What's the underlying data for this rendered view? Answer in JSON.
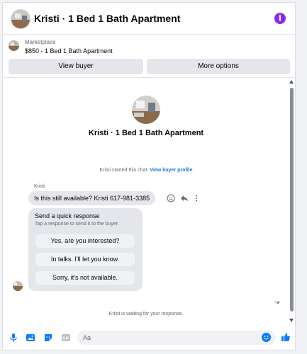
{
  "header": {
    "title": "Kristi · 1 Bed 1 Bath Apartment",
    "info_glyph": "i",
    "info_color": "#8a2be2"
  },
  "marketplace": {
    "label": "Marketplace",
    "price_title": "$850 - 1 Bed 1 Bath Apartment",
    "view_buyer": "View buyer",
    "more_options": "More options"
  },
  "thread": {
    "title": "Kristi · 1 Bed 1 Bath Apartment",
    "started_text": "Kristi started this chat.",
    "view_profile": "View buyer profile",
    "sender_name": "Kristi",
    "message": "Is this still available? Kristi 617-981-3385",
    "quick": {
      "title": "Send a quick response",
      "subtitle": "Tap a response to send it to the buyer.",
      "options": [
        "Yes, are you interested?",
        "In talks. I'll let you know.",
        "Sorry, it's not available."
      ]
    },
    "waiting": "Kristi is waiting for your response."
  },
  "composer": {
    "placeholder": "Aa",
    "accent": "#0a7cff"
  }
}
